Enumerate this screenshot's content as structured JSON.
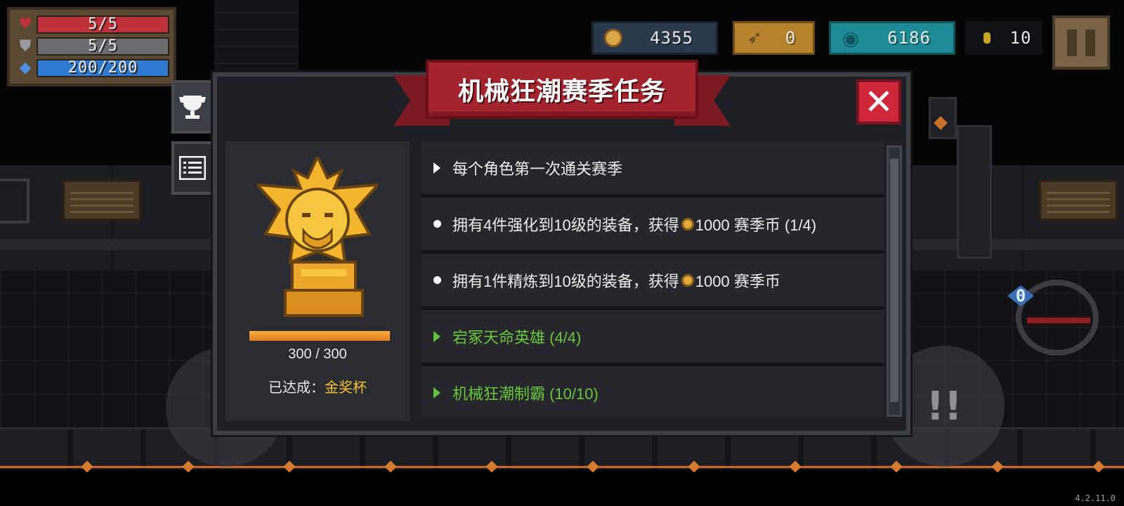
{
  "hud": {
    "health": {
      "current": 5,
      "max": 5,
      "label": "5/5",
      "color": "#c0323a"
    },
    "armor": {
      "current": 5,
      "max": 5,
      "label": "5/5",
      "color": "#6b6c70"
    },
    "energy": {
      "current": 200,
      "max": 200,
      "label": "200/200",
      "color": "#2f7ad0"
    }
  },
  "resources": {
    "season_coins": "4355",
    "fish": "0",
    "gems": "6186",
    "gold": "10"
  },
  "dialog": {
    "title": "机械狂潮赛季任务",
    "close_label": "✕",
    "progress": {
      "current": 300,
      "max": 300,
      "text": "300 / 300",
      "fraction": 1.0
    },
    "achieved_prefix": "已达成：",
    "achieved_award": "金奖杯",
    "tasks": [
      {
        "text": "每个角色第一次通关赛季",
        "marker": "triangle",
        "color": "white"
      },
      {
        "text_before": "拥有4件强化到10级的装备，获得",
        "text_after": "1000 赛季币 (1/4)",
        "marker": "dot",
        "color": "white"
      },
      {
        "text_before": "拥有1件精炼到10级的装备，获得",
        "text_after": "1000 赛季币",
        "marker": "dot",
        "color": "white"
      },
      {
        "text": "宕冢天命英雄 (4/4)",
        "marker": "triangle",
        "color": "green"
      },
      {
        "text": "机械狂潮制霸 (10/10)",
        "marker": "triangle",
        "color": "green"
      }
    ]
  },
  "weapon": {
    "energy_cost": "0"
  },
  "version": "4.2.11.0",
  "colors": {
    "accent_red": "#d0263a",
    "complete_green": "#6cc63c",
    "award_gold": "#f3c332"
  }
}
